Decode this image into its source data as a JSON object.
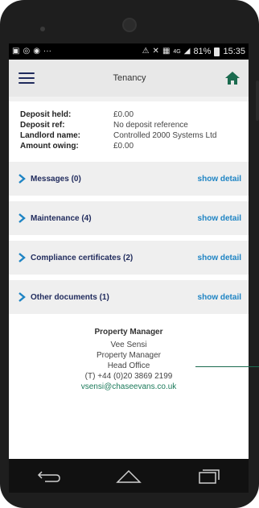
{
  "status_bar": {
    "left_icons": [
      "gallery-icon",
      "whatsapp-icon",
      "record-icon",
      "more-dots-icon"
    ],
    "more_dots": "···",
    "battery": "81%",
    "time": "15:35",
    "network": "4G"
  },
  "header": {
    "title": "Tenancy"
  },
  "details": [
    {
      "label": "Deposit held:",
      "value": "£0.00"
    },
    {
      "label": "Deposit ref:",
      "value": "No deposit reference"
    },
    {
      "label": "Landlord name:",
      "value": "Controlled 2000 Systems Ltd"
    },
    {
      "label": "Amount owing:",
      "value": "£0.00"
    }
  ],
  "sections": [
    {
      "title": "Messages (0)",
      "action": "show detail"
    },
    {
      "title": "Maintenance (4)",
      "action": "show detail"
    },
    {
      "title": "Compliance certificates (2)",
      "action": "show detail"
    },
    {
      "title": "Other documents (1)",
      "action": "show detail"
    }
  ],
  "contact": {
    "heading": "Property Manager",
    "name": "Vee Sensi",
    "role": "Property Manager",
    "office": "Head Office",
    "phone": "(T) +44 (0)20 3869 2199",
    "email": "vsensi@chaseevans.co.uk"
  },
  "colors": {
    "brand_navy": "#1f2a5c",
    "link_blue": "#1e84c4",
    "home_green": "#1b6b4f",
    "email_green": "#1b7a5a"
  }
}
